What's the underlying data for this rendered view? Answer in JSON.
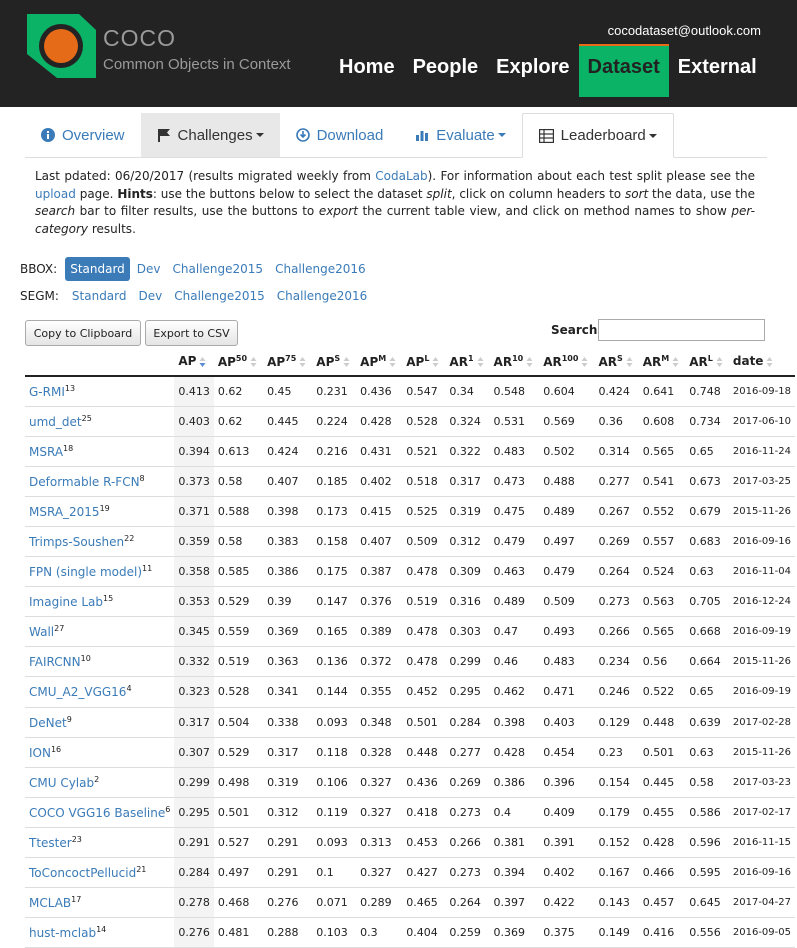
{
  "brand": {
    "title": "COCO",
    "subtitle": "Common Objects in Context",
    "email": "cocodataset@outlook.com"
  },
  "mainnav": [
    "Home",
    "People",
    "Explore",
    "Dataset",
    "External"
  ],
  "tabs": [
    "Overview",
    "Challenges",
    "Download",
    "Evaluate",
    "Leaderboard"
  ],
  "desc": {
    "p1": "Last pdated: 06/20/2017 (results migrated weekly from ",
    "codalab": "CodaLab",
    "p2": "). For information about each test split please see the ",
    "upload": "upload",
    "p3": " page. ",
    "hints": "Hints",
    "p4": ": use the buttons below to select the dataset ",
    "split": "split",
    "p5": ", click on column headers to ",
    "sort": "sort",
    "p6": " the data, use the ",
    "search": "search",
    "p7": " bar to filter results, use the buttons to ",
    "export": "export",
    "p8": " the current table view, and click on method names to show ",
    "percat": "per-category",
    "p9": " results."
  },
  "filters": {
    "bbox_label": "BBOX:",
    "segm_label": "SEGM:",
    "options": [
      "Standard",
      "Dev",
      "Challenge2015",
      "Challenge2016"
    ]
  },
  "toolbar": {
    "copy": "Copy to Clipboard",
    "export": "Export to CSV",
    "search_label": "Search:",
    "search_value": ""
  },
  "table": {
    "columns": [
      {
        "base": "AP",
        "sup": ""
      },
      {
        "base": "AP",
        "sup": "50"
      },
      {
        "base": "AP",
        "sup": "75"
      },
      {
        "base": "AP",
        "sup": "S"
      },
      {
        "base": "AP",
        "sup": "M"
      },
      {
        "base": "AP",
        "sup": "L"
      },
      {
        "base": "AR",
        "sup": "1"
      },
      {
        "base": "AR",
        "sup": "10"
      },
      {
        "base": "AR",
        "sup": "100"
      },
      {
        "base": "AR",
        "sup": "S"
      },
      {
        "base": "AR",
        "sup": "M"
      },
      {
        "base": "AR",
        "sup": "L"
      },
      {
        "base": "date",
        "sup": ""
      }
    ],
    "rows": [
      {
        "name": "G-RMI",
        "rank": "13",
        "vals": [
          "0.413",
          "0.62",
          "0.45",
          "0.231",
          "0.436",
          "0.547",
          "0.34",
          "0.548",
          "0.604",
          "0.424",
          "0.641",
          "0.748"
        ],
        "date": "2016-09-18"
      },
      {
        "name": "umd_det",
        "rank": "25",
        "vals": [
          "0.403",
          "0.62",
          "0.445",
          "0.224",
          "0.428",
          "0.528",
          "0.324",
          "0.531",
          "0.569",
          "0.36",
          "0.608",
          "0.734"
        ],
        "date": "2017-06-10"
      },
      {
        "name": "MSRA",
        "rank": "18",
        "vals": [
          "0.394",
          "0.613",
          "0.424",
          "0.216",
          "0.431",
          "0.521",
          "0.322",
          "0.483",
          "0.502",
          "0.314",
          "0.565",
          "0.65"
        ],
        "date": "2016-11-24"
      },
      {
        "name": "Deformable R-FCN",
        "rank": "8",
        "vals": [
          "0.373",
          "0.58",
          "0.407",
          "0.185",
          "0.402",
          "0.518",
          "0.317",
          "0.473",
          "0.488",
          "0.277",
          "0.541",
          "0.673"
        ],
        "date": "2017-03-25"
      },
      {
        "name": "MSRA_2015",
        "rank": "19",
        "vals": [
          "0.371",
          "0.588",
          "0.398",
          "0.173",
          "0.415",
          "0.525",
          "0.319",
          "0.475",
          "0.489",
          "0.267",
          "0.552",
          "0.679"
        ],
        "date": "2015-11-26"
      },
      {
        "name": "Trimps-Soushen",
        "rank": "22",
        "vals": [
          "0.359",
          "0.58",
          "0.383",
          "0.158",
          "0.407",
          "0.509",
          "0.312",
          "0.479",
          "0.497",
          "0.269",
          "0.557",
          "0.683"
        ],
        "date": "2016-09-16"
      },
      {
        "name": "FPN (single model)",
        "rank": "11",
        "vals": [
          "0.358",
          "0.585",
          "0.386",
          "0.175",
          "0.387",
          "0.478",
          "0.309",
          "0.463",
          "0.479",
          "0.264",
          "0.524",
          "0.63"
        ],
        "date": "2016-11-04"
      },
      {
        "name": "Imagine Lab",
        "rank": "15",
        "vals": [
          "0.353",
          "0.529",
          "0.39",
          "0.147",
          "0.376",
          "0.519",
          "0.316",
          "0.489",
          "0.509",
          "0.273",
          "0.563",
          "0.705"
        ],
        "date": "2016-12-24"
      },
      {
        "name": "Wall",
        "rank": "27",
        "vals": [
          "0.345",
          "0.559",
          "0.369",
          "0.165",
          "0.389",
          "0.478",
          "0.303",
          "0.47",
          "0.493",
          "0.266",
          "0.565",
          "0.668"
        ],
        "date": "2016-09-19"
      },
      {
        "name": "FAIRCNN",
        "rank": "10",
        "vals": [
          "0.332",
          "0.519",
          "0.363",
          "0.136",
          "0.372",
          "0.478",
          "0.299",
          "0.46",
          "0.483",
          "0.234",
          "0.56",
          "0.664"
        ],
        "date": "2015-11-26"
      },
      {
        "name": "CMU_A2_VGG16",
        "rank": "4",
        "vals": [
          "0.323",
          "0.528",
          "0.341",
          "0.144",
          "0.355",
          "0.452",
          "0.295",
          "0.462",
          "0.471",
          "0.246",
          "0.522",
          "0.65"
        ],
        "date": "2016-09-19"
      },
      {
        "name": "DeNet",
        "rank": "9",
        "vals": [
          "0.317",
          "0.504",
          "0.338",
          "0.093",
          "0.348",
          "0.501",
          "0.284",
          "0.398",
          "0.403",
          "0.129",
          "0.448",
          "0.639"
        ],
        "date": "2017-02-28"
      },
      {
        "name": "ION",
        "rank": "16",
        "vals": [
          "0.307",
          "0.529",
          "0.317",
          "0.118",
          "0.328",
          "0.448",
          "0.277",
          "0.428",
          "0.454",
          "0.23",
          "0.501",
          "0.63"
        ],
        "date": "2015-11-26"
      },
      {
        "name": "CMU Cylab",
        "rank": "2",
        "vals": [
          "0.299",
          "0.498",
          "0.319",
          "0.106",
          "0.327",
          "0.436",
          "0.269",
          "0.386",
          "0.396",
          "0.154",
          "0.445",
          "0.58"
        ],
        "date": "2017-03-23"
      },
      {
        "name": "COCO VGG16 Baseline",
        "rank": "6",
        "vals": [
          "0.295",
          "0.501",
          "0.312",
          "0.119",
          "0.327",
          "0.418",
          "0.273",
          "0.4",
          "0.409",
          "0.179",
          "0.455",
          "0.586"
        ],
        "date": "2017-02-17"
      },
      {
        "name": "Ttester",
        "rank": "23",
        "vals": [
          "0.291",
          "0.527",
          "0.291",
          "0.093",
          "0.313",
          "0.453",
          "0.266",
          "0.381",
          "0.391",
          "0.152",
          "0.428",
          "0.596"
        ],
        "date": "2016-11-15"
      },
      {
        "name": "ToConcoctPellucid",
        "rank": "21",
        "vals": [
          "0.284",
          "0.497",
          "0.291",
          "0.1",
          "0.327",
          "0.427",
          "0.273",
          "0.394",
          "0.402",
          "0.167",
          "0.466",
          "0.595"
        ],
        "date": "2016-09-16"
      },
      {
        "name": "MCLAB",
        "rank": "17",
        "vals": [
          "0.278",
          "0.468",
          "0.276",
          "0.071",
          "0.289",
          "0.465",
          "0.264",
          "0.397",
          "0.422",
          "0.143",
          "0.457",
          "0.645"
        ],
        "date": "2017-04-27"
      },
      {
        "name": "hust-mclab",
        "rank": "14",
        "vals": [
          "0.276",
          "0.481",
          "0.288",
          "0.103",
          "0.3",
          "0.404",
          "0.259",
          "0.369",
          "0.375",
          "0.149",
          "0.416",
          "0.556"
        ],
        "date": "2016-09-05"
      }
    ]
  }
}
